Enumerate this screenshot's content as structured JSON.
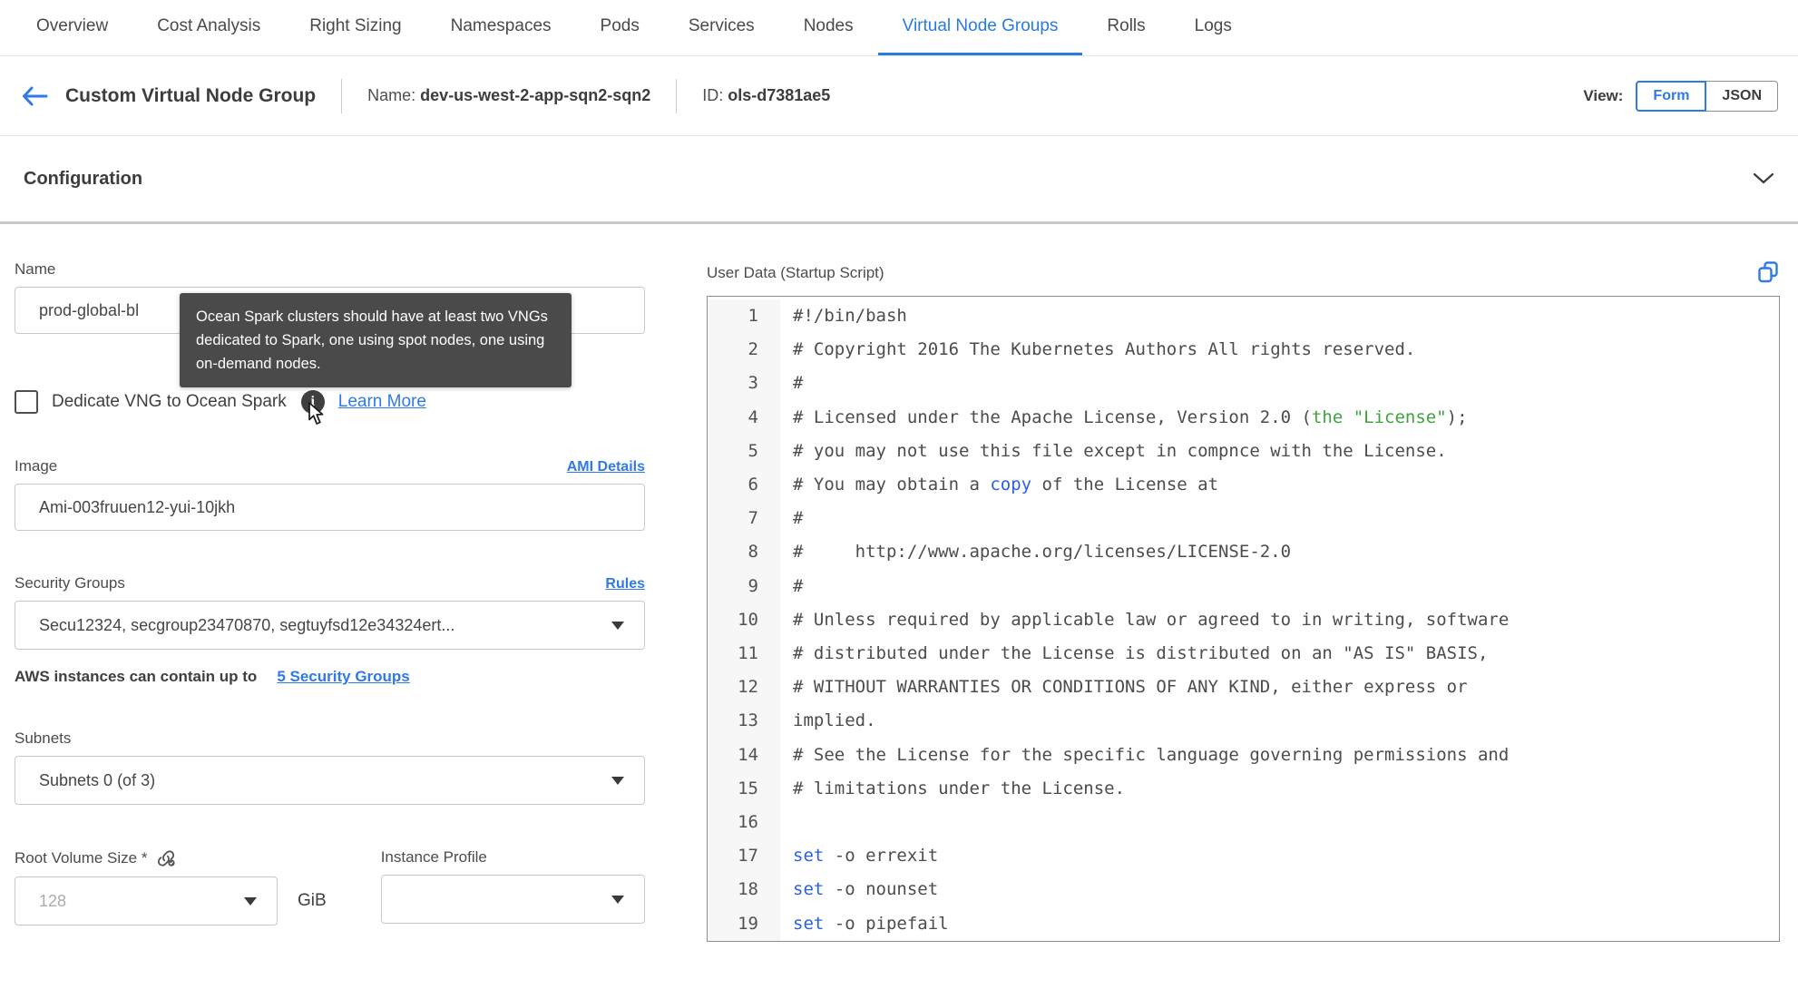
{
  "tab_bar": {
    "tabs": [
      {
        "label": "Overview",
        "active": false
      },
      {
        "label": "Cost Analysis",
        "active": false
      },
      {
        "label": "Right Sizing",
        "active": false
      },
      {
        "label": "Namespaces",
        "active": false
      },
      {
        "label": "Pods",
        "active": false
      },
      {
        "label": "Services",
        "active": false
      },
      {
        "label": "Nodes",
        "active": false
      },
      {
        "label": "Virtual Node Groups",
        "active": true
      },
      {
        "label": "Rolls",
        "active": false
      },
      {
        "label": "Logs",
        "active": false
      }
    ]
  },
  "header": {
    "title": "Custom Virtual Node Group",
    "name_label": "Name:",
    "name_value": "dev-us-west-2-app-sqn2-sqn2",
    "id_label": "ID:",
    "id_value": "ols-d7381ae5",
    "view_label": "View:",
    "view_options": [
      "Form",
      "JSON"
    ],
    "view_selected": "Form"
  },
  "section": {
    "title": "Configuration"
  },
  "form": {
    "name": {
      "label": "Name",
      "value": "prod-global-bl"
    },
    "tooltip": {
      "text": "Ocean Spark clusters should have at least two VNGs dedicated to Spark, one using spot nodes, one using on-demand nodes."
    },
    "dedicate": {
      "label": "Dedicate VNG to Ocean Spark",
      "learn_more": "Learn More",
      "checked": false
    },
    "image": {
      "label": "Image",
      "link": "AMI Details",
      "value": "Ami-003fruuen12-yui-10jkh"
    },
    "security_groups": {
      "label": "Security Groups",
      "link": "Rules",
      "value": "Secu12324, secgroup23470870, segtuyfsd12e34324ert...",
      "hint_text": "AWS instances can contain up to",
      "hint_link": "5 Security Groups"
    },
    "subnets": {
      "label": "Subnets",
      "value": "Subnets 0 (of 3)"
    },
    "root_volume": {
      "label": "Root Volume Size *",
      "placeholder": "128",
      "unit": "GiB"
    },
    "instance_profile": {
      "label": "Instance Profile",
      "value": ""
    }
  },
  "user_data": {
    "label": "User Data (Startup Script)",
    "lines": [
      {
        "num": 1,
        "segments": [
          {
            "t": "#!/bin/bash",
            "c": "d"
          }
        ]
      },
      {
        "num": 2,
        "segments": [
          {
            "t": "# Copyright 2016 The Kubernetes Authors All rights reserved.",
            "c": "d"
          }
        ]
      },
      {
        "num": 3,
        "segments": [
          {
            "t": "#",
            "c": "d"
          }
        ]
      },
      {
        "num": 4,
        "segments": [
          {
            "t": "# Licensed under the Apache License, Version 2.0 (",
            "c": "d"
          },
          {
            "t": "the \"License\"",
            "c": "g"
          },
          {
            "t": ");",
            "c": "d"
          }
        ]
      },
      {
        "num": 5,
        "segments": [
          {
            "t": "# you may not use this file except in compnce with the License.",
            "c": "d"
          }
        ]
      },
      {
        "num": 6,
        "segments": [
          {
            "t": "# You may obtain a ",
            "c": "d"
          },
          {
            "t": "copy",
            "c": "b"
          },
          {
            "t": " of the License at",
            "c": "d"
          }
        ]
      },
      {
        "num": 7,
        "segments": [
          {
            "t": "#",
            "c": "d"
          }
        ]
      },
      {
        "num": 8,
        "segments": [
          {
            "t": "#     http://www.apache.org/licenses/LICENSE-2.0",
            "c": "d"
          }
        ]
      },
      {
        "num": 9,
        "segments": [
          {
            "t": "#",
            "c": "d"
          }
        ]
      },
      {
        "num": 10,
        "segments": [
          {
            "t": "# Unless required by applicable law or agreed to in writing, software",
            "c": "d"
          }
        ]
      },
      {
        "num": 11,
        "segments": [
          {
            "t": "# distributed under the License is distributed on an \"AS IS\" BASIS,",
            "c": "d"
          }
        ]
      },
      {
        "num": 12,
        "segments": [
          {
            "t": "# WITHOUT WARRANTIES OR CONDITIONS OF ANY KIND, either express or",
            "c": "d"
          }
        ]
      },
      {
        "num": 13,
        "segments": [
          {
            "t": "implied.",
            "c": "d"
          }
        ]
      },
      {
        "num": 14,
        "segments": [
          {
            "t": "# See the License for the specific language governing permissions and",
            "c": "d"
          }
        ]
      },
      {
        "num": 15,
        "segments": [
          {
            "t": "# limitations under the License.",
            "c": "d"
          }
        ]
      },
      {
        "num": 16,
        "segments": []
      },
      {
        "num": 17,
        "segments": [
          {
            "t": "set",
            "c": "b"
          },
          {
            "t": " -o errexit",
            "c": "d"
          }
        ]
      },
      {
        "num": 18,
        "segments": [
          {
            "t": "set",
            "c": "b"
          },
          {
            "t": " -o nounset",
            "c": "d"
          }
        ]
      },
      {
        "num": 19,
        "segments": [
          {
            "t": "set",
            "c": "b"
          },
          {
            "t": " -o pipefail",
            "c": "d"
          }
        ]
      }
    ]
  },
  "colors": {
    "accent_blue": "#2f7ae8",
    "active_tab_blue": "#2b7bdf",
    "code_keyword_blue": "#2a5fe8",
    "code_string_green": "#3da43d",
    "tooltip_bg": "#4a4a4a"
  }
}
